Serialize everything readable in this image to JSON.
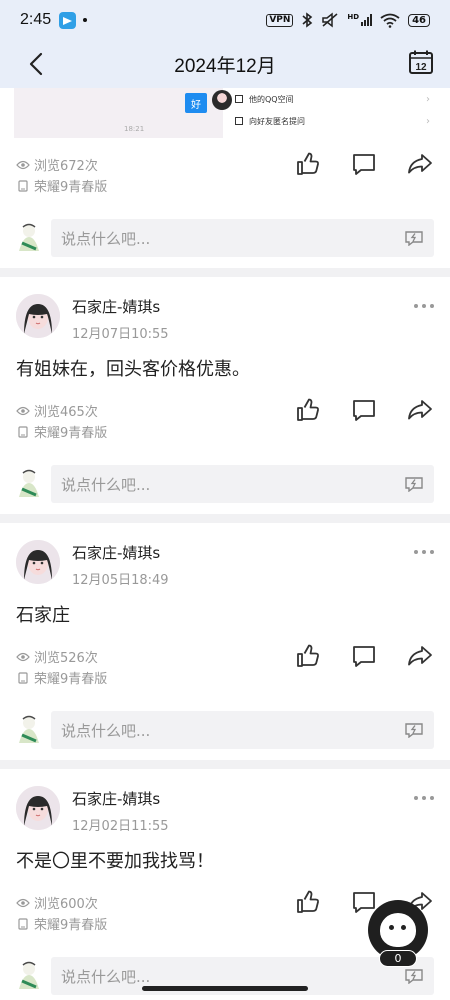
{
  "status_bar": {
    "time": "2:45",
    "vpn": "VPN",
    "network": "HD",
    "battery": "46"
  },
  "header": {
    "title": "2024年12月",
    "calendar_day": "12"
  },
  "previous_post": {
    "screenshot": {
      "chat_bubble": "好",
      "time": "18:21",
      "menu_items": [
        "他的QQ空间",
        "向好友匿名提问"
      ]
    },
    "views": "浏览672次",
    "device": "荣耀9青春版",
    "comment_placeholder": "说点什么吧..."
  },
  "posts": [
    {
      "author": "石家庄-婧琪s",
      "time": "12月07日10:55",
      "text": "有姐妹在，回头客价格优惠。",
      "views": "浏览465次",
      "device": "荣耀9青春版",
      "comment_placeholder": "说点什么吧..."
    },
    {
      "author": "石家庄-婧琪s",
      "time": "12月05日18:49",
      "text": "石家庄",
      "views": "浏览526次",
      "device": "荣耀9青春版",
      "comment_placeholder": "说点什么吧..."
    },
    {
      "author": "石家庄-婧琪s",
      "time": "12月02日11:55",
      "text": "不是〇里不要加我找骂！",
      "views": "浏览600次",
      "device": "荣耀9青春版",
      "comment_placeholder": "说点什么吧..."
    }
  ],
  "floating_button": {
    "badge": "0"
  },
  "colors": {
    "header_bg": "#e8eef9",
    "accent_blue": "#1e8cf0",
    "divider": "#f1f1f3"
  }
}
